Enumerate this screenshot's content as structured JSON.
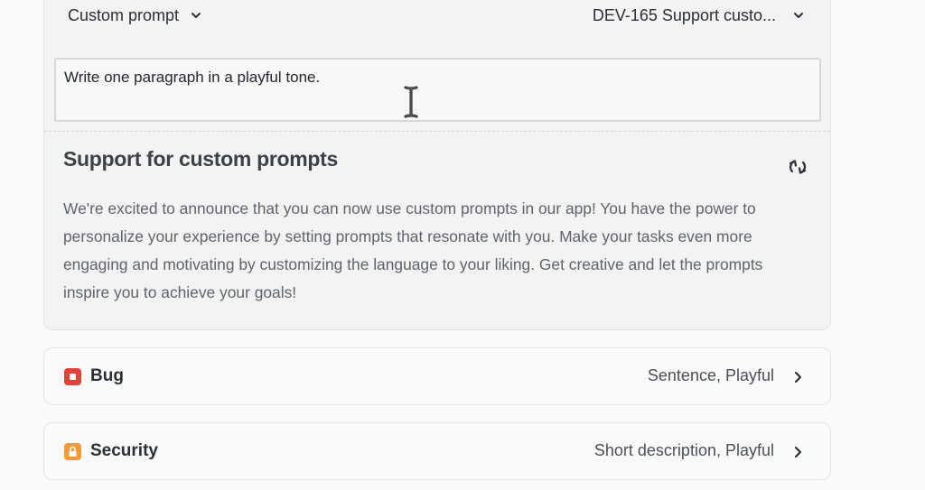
{
  "composer": {
    "prompt_selector_label": "Custom prompt",
    "issue_selector_label": "DEV-165 Support custo...",
    "prompt_input_value": "Write one paragraph in a playful tone.",
    "result_title": "Support for custom prompts",
    "result_body": "We're excited to announce that you can now use custom prompts in our app! You have the power to personalize your experience by setting prompts that resonate with you. Make your tasks even more engaging and motivating by customizing the language to your liking. Get creative and let the prompts inspire you to achieve your goals!"
  },
  "options": [
    {
      "label": "Bug",
      "value": "Sentence, Playful",
      "icon": "bug-icon",
      "color": "#e0413a"
    },
    {
      "label": "Security",
      "value": "Short description, Playful",
      "icon": "lock-icon",
      "color": "#f29a38"
    }
  ],
  "icons": {
    "dropdown": "chevron-down-icon",
    "refresh": "refresh-icon",
    "row_arrow": "chevron-right-icon",
    "cursor": "text-cursor-icon"
  }
}
